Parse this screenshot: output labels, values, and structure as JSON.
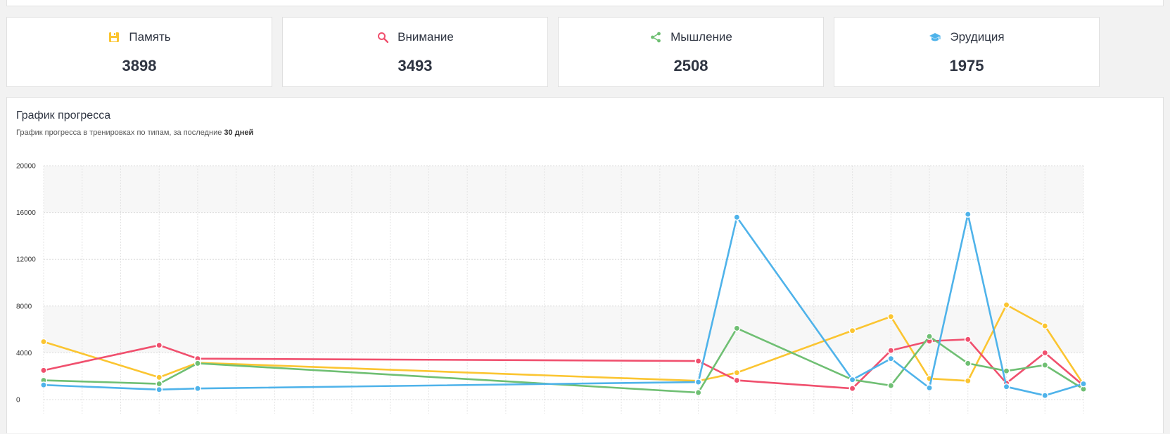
{
  "stats": [
    {
      "label": "Память",
      "value": "3898",
      "icon": "floppy-icon",
      "color": "#fbc531"
    },
    {
      "label": "Внимание",
      "value": "3493",
      "icon": "search-icon",
      "color": "#f0506e"
    },
    {
      "label": "Мышление",
      "value": "2508",
      "icon": "share-icon",
      "color": "#6fbf73"
    },
    {
      "label": "Эрудиция",
      "value": "1975",
      "icon": "graduation-cap-icon",
      "color": "#4fb3ea"
    }
  ],
  "panel": {
    "title": "График прогресса",
    "subtitle_prefix": "График прогресса в тренировках по типам, за последние ",
    "subtitle_bold": "30 дней"
  },
  "chart_data": {
    "type": "line",
    "x": [
      0,
      3,
      4,
      17,
      18,
      22,
      23,
      24,
      25,
      26,
      27
    ],
    "ylim": [
      0,
      20000
    ],
    "yticks": [
      0,
      4000,
      8000,
      12000,
      16000,
      20000
    ],
    "grid": true,
    "series": [
      {
        "color": "#fbc531",
        "values": [
          4950,
          1900,
          3150,
          1600,
          2300,
          5900,
          7100,
          1800,
          1600,
          8100,
          6300,
          1300
        ]
      },
      {
        "color": "#f0506e",
        "values": [
          2500,
          4650,
          3500,
          3300,
          1650,
          950,
          4200,
          5000,
          5150,
          1400,
          4000,
          1200
        ]
      },
      {
        "color": "#6fbf73",
        "values": [
          1650,
          1350,
          3100,
          600,
          6100,
          1700,
          1200,
          5400,
          3100,
          2450,
          2950,
          900
        ]
      },
      {
        "color": "#4fb3ea",
        "values": [
          1250,
          850,
          950,
          1500,
          15600,
          1700,
          3500,
          1000,
          15850,
          1100,
          350,
          1350
        ]
      }
    ],
    "x_values": [
      0,
      3,
      4,
      17,
      18,
      21,
      22,
      23,
      24,
      25,
      26,
      27
    ]
  }
}
